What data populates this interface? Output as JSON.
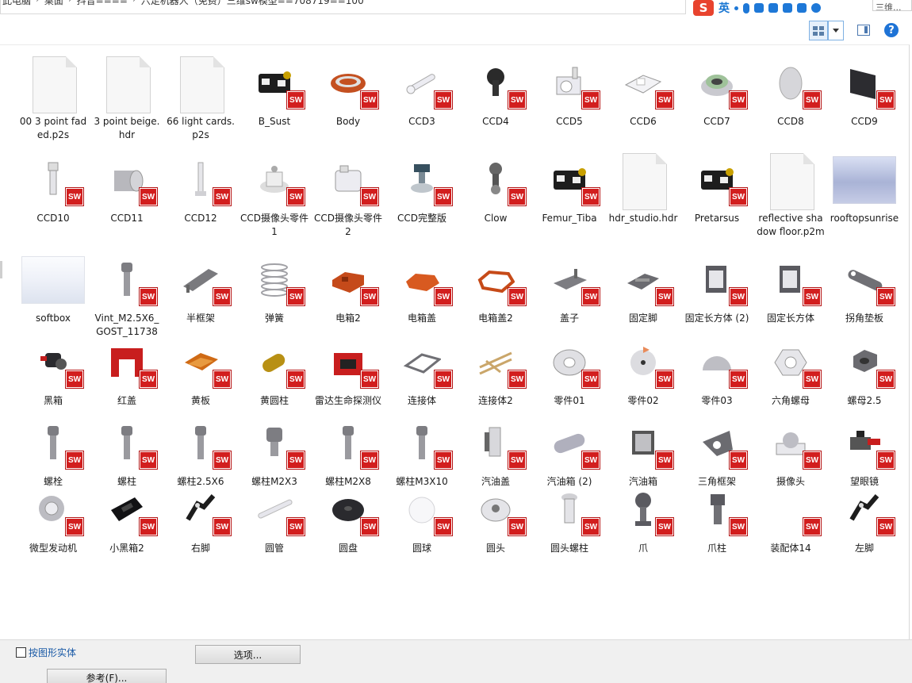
{
  "breadcrumb": [
    "此电脑",
    "桌面",
    "抖音====",
    "六足机器人（免费）三维sw模型==708719==100"
  ],
  "ime": {
    "logo": "S",
    "lang": "英"
  },
  "search_partial": "三维...",
  "help_label": "?",
  "files": [
    {
      "name": "00 3 point faded.p2s",
      "type": "doc"
    },
    {
      "name": "3 point beige.hdr",
      "type": "doc"
    },
    {
      "name": "66 light cards.p2s",
      "type": "doc"
    },
    {
      "name": "B_Sust",
      "type": "sw",
      "shape": "bsust"
    },
    {
      "name": "Body",
      "type": "sw",
      "shape": "body"
    },
    {
      "name": "CCD3",
      "type": "sw",
      "shape": "pin"
    },
    {
      "name": "CCD4",
      "type": "sw",
      "shape": "knob"
    },
    {
      "name": "CCD5",
      "type": "sw",
      "shape": "block"
    },
    {
      "name": "CCD6",
      "type": "sw",
      "shape": "frame"
    },
    {
      "name": "CCD7",
      "type": "sw",
      "shape": "lens"
    },
    {
      "name": "CCD8",
      "type": "sw",
      "shape": "disc"
    },
    {
      "name": "CCD9",
      "type": "sw",
      "shape": "plate"
    },
    {
      "name": "CCD10",
      "type": "sw",
      "shape": "post"
    },
    {
      "name": "CCD11",
      "type": "sw",
      "shape": "cyl"
    },
    {
      "name": "CCD12",
      "type": "sw",
      "shape": "rod"
    },
    {
      "name": "CCD摄像头零件1",
      "type": "sw",
      "shape": "cam1"
    },
    {
      "name": "CCD摄像头零件2",
      "type": "sw",
      "shape": "cam2"
    },
    {
      "name": "CCD完整版",
      "type": "sw",
      "shape": "camfull"
    },
    {
      "name": "Clow",
      "type": "sw",
      "shape": "clow"
    },
    {
      "name": "Femur_Tiba",
      "type": "sw",
      "shape": "bsust"
    },
    {
      "name": "hdr_studio.hdr",
      "type": "doc"
    },
    {
      "name": "Pretarsus",
      "type": "sw",
      "shape": "bsust"
    },
    {
      "name": "reflective shadow floor.p2m",
      "type": "doc"
    },
    {
      "name": "rooftopsunrise",
      "type": "photo",
      "variant": "rooftop"
    },
    {
      "name": "softbox",
      "type": "photo",
      "variant": "softbox"
    },
    {
      "name": "Vint_M2.5X6_GOST_11738",
      "type": "sw",
      "shape": "screw"
    },
    {
      "name": "半框架",
      "type": "sw",
      "shape": "halfframe"
    },
    {
      "name": "弹簧",
      "type": "sw",
      "shape": "spring"
    },
    {
      "name": "电箱2",
      "type": "sw",
      "shape": "orangebox"
    },
    {
      "name": "电箱盖",
      "type": "sw",
      "shape": "orangelid"
    },
    {
      "name": "电箱盖2",
      "type": "sw",
      "shape": "orangering"
    },
    {
      "name": "盖子",
      "type": "sw",
      "shape": "cover"
    },
    {
      "name": "固定脚",
      "type": "sw",
      "shape": "mountfoot"
    },
    {
      "name": "固定长方体 (2)",
      "type": "sw",
      "shape": "cuboid"
    },
    {
      "name": "固定长方体",
      "type": "sw",
      "shape": "cuboid"
    },
    {
      "name": "拐角垫板",
      "type": "sw",
      "shape": "bar"
    },
    {
      "name": "黑箱",
      "type": "sw",
      "shape": "blackbox"
    },
    {
      "name": "红盖",
      "type": "sw",
      "shape": "redcover"
    },
    {
      "name": "黄板",
      "type": "sw",
      "shape": "yellowboard"
    },
    {
      "name": "黄圆柱",
      "type": "sw",
      "shape": "yellowcyl"
    },
    {
      "name": "雷达生命探测仪",
      "type": "sw",
      "shape": "radar"
    },
    {
      "name": "连接体",
      "type": "sw",
      "shape": "connector"
    },
    {
      "name": "连接体2",
      "type": "sw",
      "shape": "connector2"
    },
    {
      "name": "零件01",
      "type": "sw",
      "shape": "nutbig"
    },
    {
      "name": "零件02",
      "type": "sw",
      "shape": "sphere"
    },
    {
      "name": "零件03",
      "type": "sw",
      "shape": "dome"
    },
    {
      "name": "六角螺母",
      "type": "sw",
      "shape": "hexnut"
    },
    {
      "name": "螺母2.5",
      "type": "sw",
      "shape": "nutdark"
    },
    {
      "name": "螺栓",
      "type": "sw",
      "shape": "screw"
    },
    {
      "name": "螺柱",
      "type": "sw",
      "shape": "screw"
    },
    {
      "name": "螺柱2.5X6",
      "type": "sw",
      "shape": "screw"
    },
    {
      "name": "螺柱M2X3",
      "type": "sw",
      "shape": "screwshort"
    },
    {
      "name": "螺柱M2X8",
      "type": "sw",
      "shape": "screw"
    },
    {
      "name": "螺柱M3X10",
      "type": "sw",
      "shape": "screw"
    },
    {
      "name": "汽油盖",
      "type": "sw",
      "shape": "fuelcap"
    },
    {
      "name": "汽油箱 (2)",
      "type": "sw",
      "shape": "tank"
    },
    {
      "name": "汽油箱",
      "type": "sw",
      "shape": "fueltank"
    },
    {
      "name": "三角框架",
      "type": "sw",
      "shape": "triframe"
    },
    {
      "name": "摄像头",
      "type": "sw",
      "shape": "camera"
    },
    {
      "name": "望眼镜",
      "type": "sw",
      "shape": "telescope"
    },
    {
      "name": "微型发动机",
      "type": "sw",
      "shape": "motor"
    },
    {
      "name": "小黑箱2",
      "type": "sw",
      "shape": "smallblackbox"
    },
    {
      "name": "右脚",
      "type": "sw",
      "shape": "foot"
    },
    {
      "name": "圆管",
      "type": "sw",
      "shape": "tube"
    },
    {
      "name": "圆盘",
      "type": "sw",
      "shape": "disk"
    },
    {
      "name": "圆球",
      "type": "sw",
      "shape": "ball"
    },
    {
      "name": "圆头",
      "type": "sw",
      "shape": "roundhead"
    },
    {
      "name": "圆头螺柱",
      "type": "sw",
      "shape": "roundbolt"
    },
    {
      "name": "爪",
      "type": "sw",
      "shape": "claw"
    },
    {
      "name": "爪柱",
      "type": "sw",
      "shape": "clawpost"
    },
    {
      "name": "装配体14",
      "type": "sw",
      "shape": "empty"
    },
    {
      "name": "左脚",
      "type": "sw",
      "shape": "foot"
    }
  ],
  "sw_badge": "SW",
  "bottom": {
    "checkbox_label": "按图形实体",
    "options_button": "选项...",
    "reference_button": "参考(F)..."
  },
  "colors": {
    "accent": "#1e73d6",
    "sw_red": "#d21e1e",
    "link": "#1a5aa6"
  }
}
